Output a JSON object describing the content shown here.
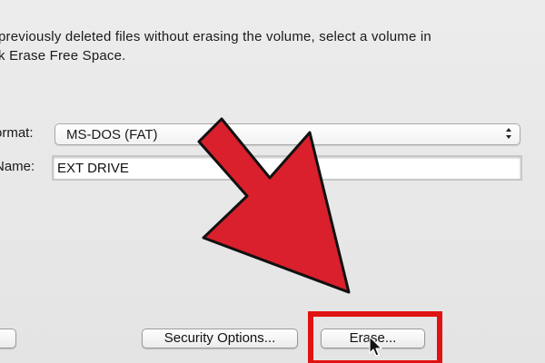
{
  "description": {
    "line1": "previously deleted files without erasing the volume, select a volume in",
    "line2": "k Erase Free Space."
  },
  "format": {
    "label": "ormat:",
    "selected": "MS-DOS (FAT)"
  },
  "name": {
    "label": "Name:",
    "value": "EXT DRIVE"
  },
  "buttons": {
    "left_label": "",
    "security_options": "Security Options...",
    "erase": "Erase..."
  },
  "annotation": {
    "arrow_color": "#d9202c",
    "arrow_outline": "#111111",
    "highlight_color": "#e01212"
  }
}
